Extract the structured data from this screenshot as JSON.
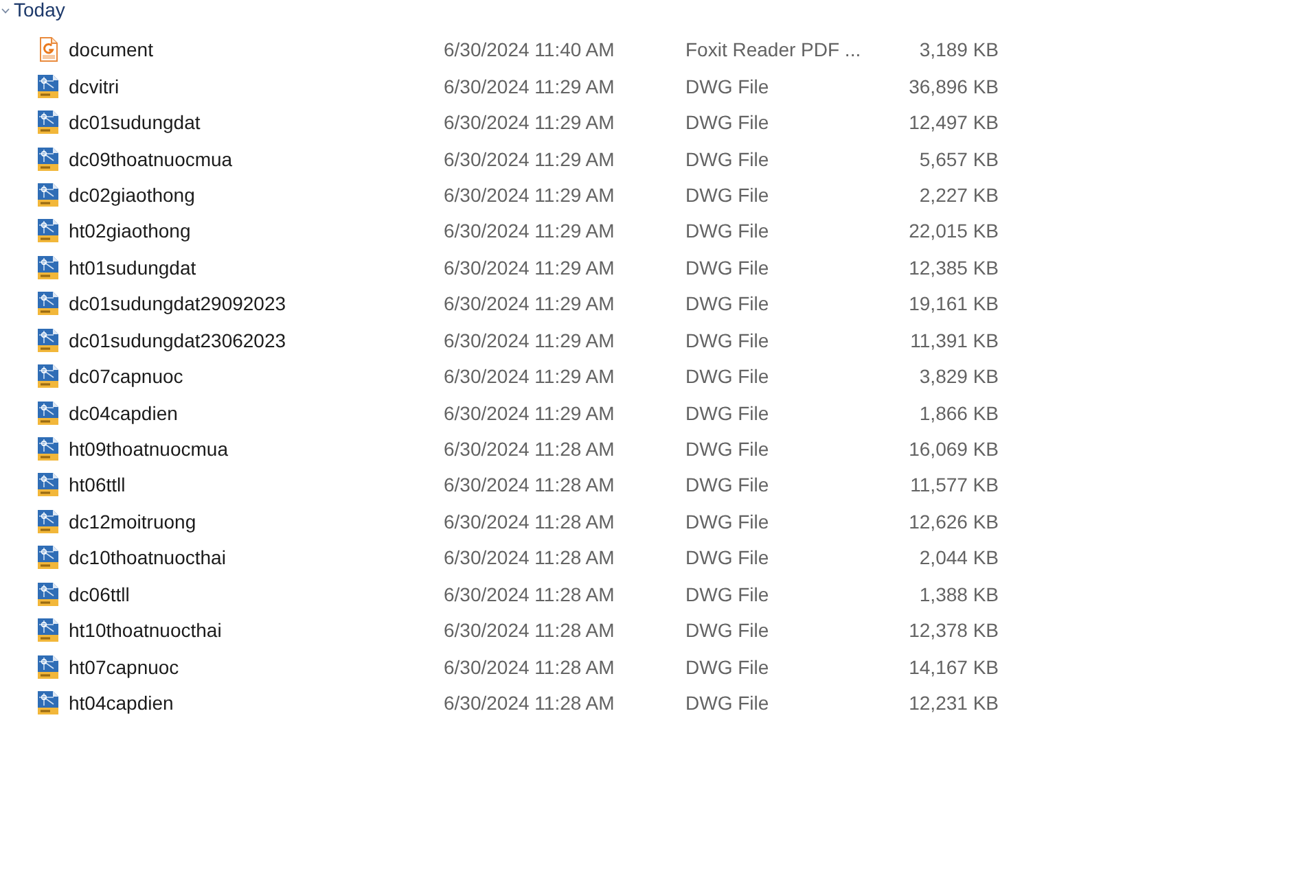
{
  "group": {
    "label": "Today",
    "expanded": true
  },
  "files": [
    {
      "kind": "pdf",
      "name": "document",
      "date": "6/30/2024 11:40 AM",
      "type": "Foxit Reader PDF ...",
      "size": "3,189 KB"
    },
    {
      "kind": "dwg",
      "name": "dcvitri",
      "date": "6/30/2024 11:29 AM",
      "type": "DWG File",
      "size": "36,896 KB"
    },
    {
      "kind": "dwg",
      "name": "dc01sudungdat",
      "date": "6/30/2024 11:29 AM",
      "type": "DWG File",
      "size": "12,497 KB"
    },
    {
      "kind": "dwg",
      "name": "dc09thoatnuocmua",
      "date": "6/30/2024 11:29 AM",
      "type": "DWG File",
      "size": "5,657 KB"
    },
    {
      "kind": "dwg",
      "name": "dc02giaothong",
      "date": "6/30/2024 11:29 AM",
      "type": "DWG File",
      "size": "2,227 KB"
    },
    {
      "kind": "dwg",
      "name": "ht02giaothong",
      "date": "6/30/2024 11:29 AM",
      "type": "DWG File",
      "size": "22,015 KB"
    },
    {
      "kind": "dwg",
      "name": "ht01sudungdat",
      "date": "6/30/2024 11:29 AM",
      "type": "DWG File",
      "size": "12,385 KB"
    },
    {
      "kind": "dwg",
      "name": "dc01sudungdat29092023",
      "date": "6/30/2024 11:29 AM",
      "type": "DWG File",
      "size": "19,161 KB"
    },
    {
      "kind": "dwg",
      "name": "dc01sudungdat23062023",
      "date": "6/30/2024 11:29 AM",
      "type": "DWG File",
      "size": "11,391 KB"
    },
    {
      "kind": "dwg",
      "name": "dc07capnuoc",
      "date": "6/30/2024 11:29 AM",
      "type": "DWG File",
      "size": "3,829 KB"
    },
    {
      "kind": "dwg",
      "name": "dc04capdien",
      "date": "6/30/2024 11:29 AM",
      "type": "DWG File",
      "size": "1,866 KB"
    },
    {
      "kind": "dwg",
      "name": "ht09thoatnuocmua",
      "date": "6/30/2024 11:28 AM",
      "type": "DWG File",
      "size": "16,069 KB"
    },
    {
      "kind": "dwg",
      "name": "ht06ttll",
      "date": "6/30/2024 11:28 AM",
      "type": "DWG File",
      "size": "11,577 KB"
    },
    {
      "kind": "dwg",
      "name": "dc12moitruong",
      "date": "6/30/2024 11:28 AM",
      "type": "DWG File",
      "size": "12,626 KB"
    },
    {
      "kind": "dwg",
      "name": "dc10thoatnuocthai",
      "date": "6/30/2024 11:28 AM",
      "type": "DWG File",
      "size": "2,044 KB"
    },
    {
      "kind": "dwg",
      "name": "dc06ttll",
      "date": "6/30/2024 11:28 AM",
      "type": "DWG File",
      "size": "1,388 KB"
    },
    {
      "kind": "dwg",
      "name": "ht10thoatnuocthai",
      "date": "6/30/2024 11:28 AM",
      "type": "DWG File",
      "size": "12,378 KB"
    },
    {
      "kind": "dwg",
      "name": "ht07capnuoc",
      "date": "6/30/2024 11:28 AM",
      "type": "DWG File",
      "size": "14,167 KB"
    },
    {
      "kind": "dwg",
      "name": "ht04capdien",
      "date": "6/30/2024 11:28 AM",
      "type": "DWG File",
      "size": "12,231 KB"
    }
  ]
}
